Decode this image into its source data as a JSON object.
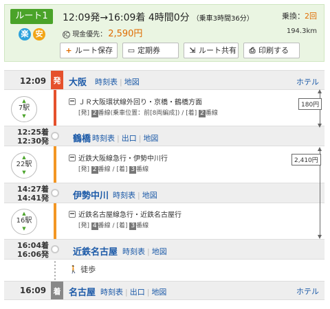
{
  "summary": {
    "route_label": "ルート1",
    "badge_easy": "楽",
    "badge_safe": "安",
    "time_text": "12:09発→16:09着 4時間0分",
    "ride_text": "（乗車3時間36分）",
    "transfers_label": "乗換：",
    "transfers_count": "2回",
    "fare_icon": "IC",
    "fare_label": "現金優先：",
    "fare_price": "2,590円",
    "distance": "194.3km",
    "buttons": {
      "save": "ルート保存",
      "commuter": "定期券",
      "share": "ルート共有",
      "print": "印刷する"
    }
  },
  "stations": [
    {
      "time": "12:09",
      "mark": "発",
      "name": "大阪",
      "links": [
        "時刻表",
        "地図"
      ],
      "hotel": "ホテル"
    },
    {
      "arr": "12:25着",
      "dep": "12:30発",
      "name": "鶴橋",
      "links": [
        "時刻表",
        "出口",
        "地図"
      ]
    },
    {
      "arr": "14:27着",
      "dep": "14:41発",
      "name": "伊勢中川",
      "links": [
        "時刻表",
        "地図"
      ]
    },
    {
      "arr": "16:04着",
      "dep": "16:06発",
      "name": "近鉄名古屋",
      "links": [
        "時刻表",
        "地図"
      ]
    },
    {
      "time": "16:09",
      "mark": "着",
      "name": "名古屋",
      "links": [
        "時刻表",
        "出口",
        "地図"
      ],
      "hotel": "ホテル"
    }
  ],
  "segments": [
    {
      "stops": "7駅",
      "line": "ＪＲ大阪環状線外回り・京橋・鶴橋方面",
      "platform": [
        "[発]",
        "2",
        "番線(乗車位置：前[8両編成])",
        "/",
        "[着]",
        "2",
        "番線"
      ]
    },
    {
      "stops": "22駅",
      "line": "近鉄大阪線急行・伊勢中川行",
      "platform": [
        "[発]",
        "2",
        "番線",
        "/",
        "[着]",
        "3",
        "番線"
      ]
    },
    {
      "stops": "16駅",
      "line": "近鉄名古屋線急行・近鉄名古屋行",
      "platform": [
        "[発]",
        "4",
        "番線",
        "/",
        "[着]",
        "3",
        "番線"
      ]
    }
  ],
  "fares": [
    "180円",
    "2,410円"
  ],
  "walk": "徒歩",
  "colors": {
    "green": "#4aa329",
    "red": "#e5502c",
    "orange": "#f39623",
    "link": "#1c5aa8",
    "price": "#e06c00"
  }
}
